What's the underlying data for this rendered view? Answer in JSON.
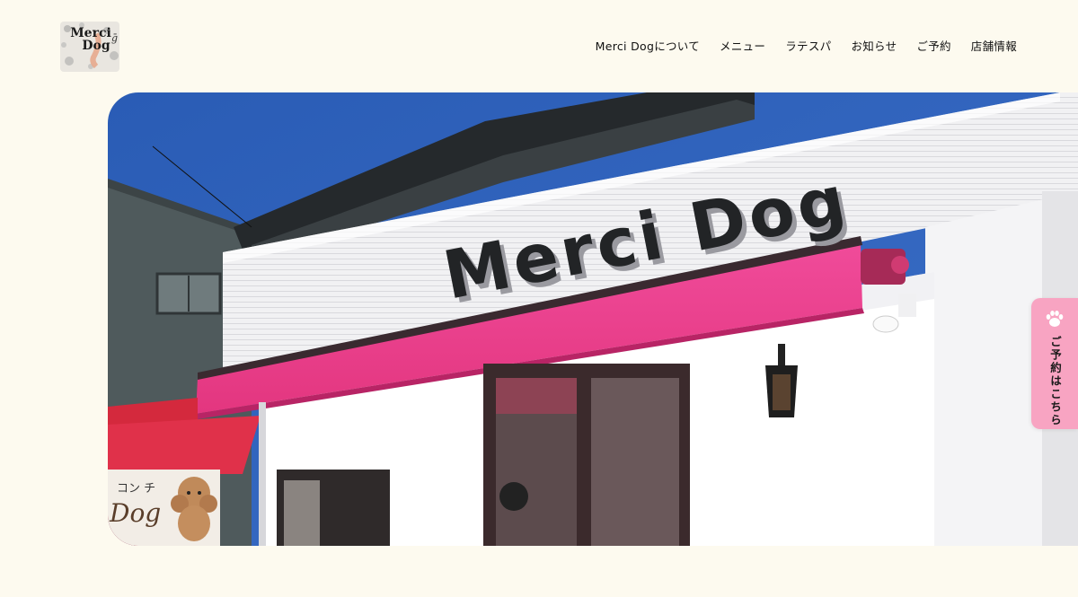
{
  "brand": {
    "logo_line1": "Merci",
    "logo_line2": "Dog",
    "logo_script": "ḡ"
  },
  "nav": {
    "items": [
      {
        "label": "Merci Dogについて"
      },
      {
        "label": "メニュー"
      },
      {
        "label": "ラテスパ"
      },
      {
        "label": "お知らせ"
      },
      {
        "label": "ご予約"
      },
      {
        "label": "店舗情報"
      }
    ]
  },
  "hero": {
    "sign_text": "Merci Dog",
    "board_text_top": "コン チ",
    "board_text_main": "Dog"
  },
  "reserve": {
    "label": "ご予約はこちら",
    "icon": "paw-icon"
  },
  "colors": {
    "background": "#fdfaef",
    "accent_pink": "#f8a4c2",
    "awning_pink": "#ea3e8e",
    "sky": "#2f61b8"
  }
}
